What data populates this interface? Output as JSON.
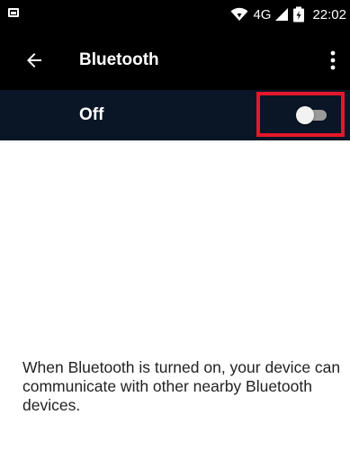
{
  "status_bar": {
    "network": "4G",
    "time": "22:02"
  },
  "toolbar": {
    "title": "Bluetooth"
  },
  "bluetooth_switch": {
    "label": "Off",
    "state": "off",
    "highlight_color": "#e3192b"
  },
  "main": {
    "info_text": "When Bluetooth is turned on, your device can communicate with other nearby Bluetooth devices."
  },
  "colors": {
    "toolbar_bg": "#000000",
    "switch_bar_bg": "#0a1526",
    "background": "#ffffff"
  },
  "icons": [
    "image-notification-icon",
    "wifi-icon",
    "signal-icon",
    "battery-icon",
    "back-arrow-icon",
    "more-options-icon"
  ]
}
